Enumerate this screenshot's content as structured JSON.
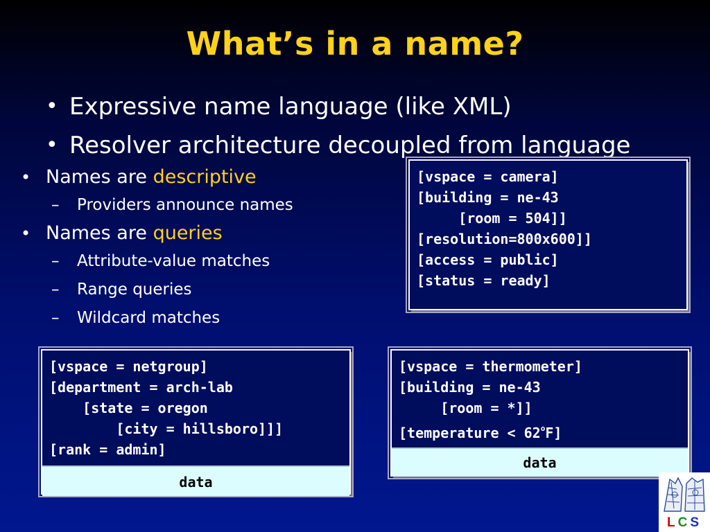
{
  "title": "What’s in a name?",
  "top_bullets": [
    "Expressive name language (like XML)",
    "Resolver architecture decoupled from language"
  ],
  "bullets": {
    "descriptive": {
      "prefix": "Names are ",
      "highlight": "descriptive",
      "sub": [
        "Providers announce names"
      ]
    },
    "queries": {
      "prefix": "Names are ",
      "highlight": "queries",
      "sub": [
        "Attribute-value matches",
        "Range queries",
        "Wildcard matches"
      ]
    }
  },
  "box_camera": {
    "lines": [
      "[vspace = camera]",
      "[building = ne-43",
      "     [room = 504]]",
      "[resolution=800x600]]",
      "[access = public]",
      "[status = ready]"
    ]
  },
  "box_netgroup": {
    "lines": [
      "[vspace = netgroup]",
      "[department = arch-lab",
      "    [state = oregon",
      "        [city = hillsboro]]]",
      "[rank = admin]"
    ],
    "data_label": "data"
  },
  "box_thermo": {
    "lines": [
      "[vspace = thermometer]",
      "[building = ne-43",
      "     [room = *]]"
    ],
    "temp_prefix": "[temperature < 62",
    "temp_degree": "o",
    "temp_suffix": "F]",
    "data_label": "data"
  },
  "logo": {
    "letters": [
      "L",
      "C",
      "S"
    ]
  },
  "colors": {
    "title": "#ffd21a",
    "highlight": "#ffd21a",
    "box_bg": "#000c5c",
    "data_band": "#dcfdfd",
    "background_top": "#000000",
    "background_bottom": "#00178e"
  }
}
